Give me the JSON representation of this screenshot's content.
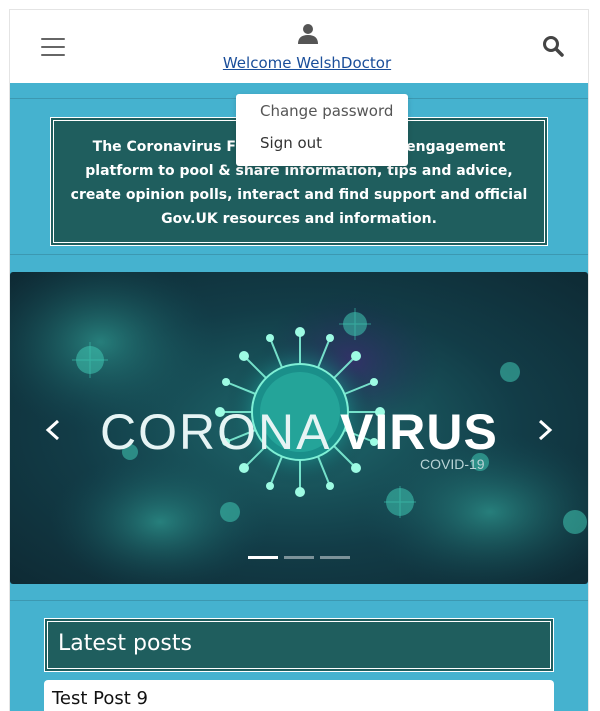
{
  "navbar": {
    "welcome_link": "Welcome WelshDoctor",
    "icons": [
      "hamburger-menu-icon",
      "user-icon",
      "search-icon"
    ]
  },
  "user_menu": {
    "items": [
      "Change password",
      "Sign out"
    ]
  },
  "intro": {
    "text": "The Coronavirus Forum is a community engagement platform to pool & share information, tips and advice, create opinion polls, interact and find support and official Gov.UK resources and information."
  },
  "carousel": {
    "slide_heading_light": "CORONA",
    "slide_heading_bold": "VIRUS",
    "slide_subheading": "COVID-19",
    "slide_count": 3,
    "active_slide": 1
  },
  "latest_posts": {
    "heading": "Latest posts",
    "posts": [
      "Test Post 9"
    ]
  },
  "colors": {
    "page_bg": "#45b2cf",
    "panel_bg": "#1f5e5e",
    "link": "#1a4e9a"
  }
}
